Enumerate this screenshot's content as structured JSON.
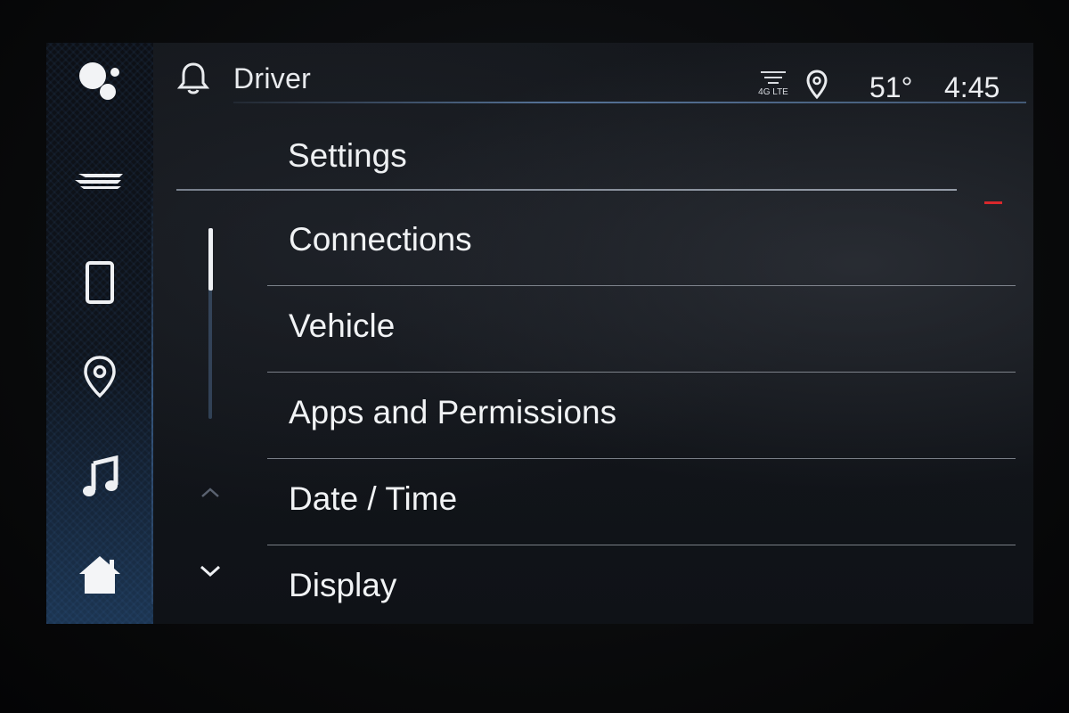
{
  "header": {
    "profile_name": "Driver",
    "network_label": "4G LTE",
    "temperature": "51°",
    "time": "4:45"
  },
  "sidebar": {
    "items": [
      {
        "icon": "google-assistant-icon"
      },
      {
        "icon": "brand-logo-icon"
      },
      {
        "icon": "phone-icon"
      },
      {
        "icon": "navigation-pin-icon"
      },
      {
        "icon": "music-note-icon"
      },
      {
        "icon": "home-icon"
      }
    ]
  },
  "page": {
    "title": "Settings"
  },
  "settings_list": {
    "items": [
      {
        "label": "Connections"
      },
      {
        "label": "Vehicle"
      },
      {
        "label": "Apps and Permissions"
      },
      {
        "label": "Date / Time"
      },
      {
        "label": "Display"
      }
    ],
    "scroll_position": 0.0
  },
  "colors": {
    "accent_line": "#6e96c8",
    "indicator_red": "#d8282c",
    "text": "#f1f3f5"
  }
}
